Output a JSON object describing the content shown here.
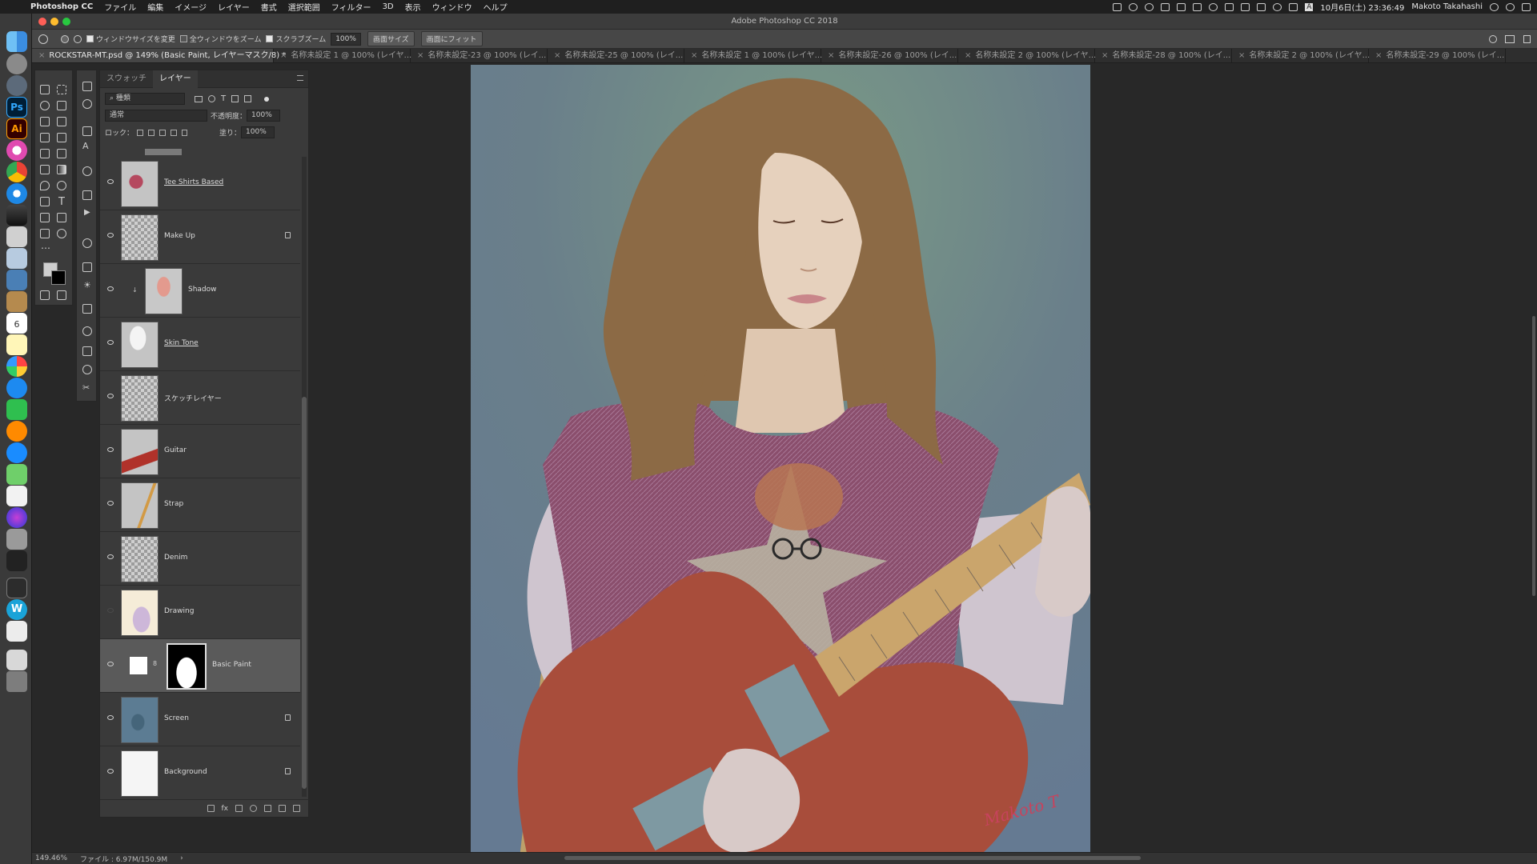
{
  "menubar": {
    "app_name": "Photoshop CC",
    "items": [
      "ファイル",
      "編集",
      "イメージ",
      "レイヤー",
      "書式",
      "選択範囲",
      "フィルター",
      "3D",
      "表示",
      "ウィンドウ",
      "ヘルプ"
    ],
    "datetime": "10月6日(土) 23:36:49",
    "user": "Makoto Takahashi",
    "input_mode": "A"
  },
  "window": {
    "title": "Adobe Photoshop CC 2018"
  },
  "options": {
    "resize_windows_label": "ウィンドウサイズを変更",
    "zoom_all_label": "全ウィンドウをズーム",
    "scrubby_zoom_label": "スクラブズーム",
    "zoom_value": "100%",
    "fit_screen_button": "画面サイズ",
    "fill_screen_button": "画面にフィット"
  },
  "tabs": [
    "ROCKSTAR-MT.psd @ 149% (Basic Paint, レイヤーマスク/8) *",
    "名称未設定 1 @ 100% (レイヤ...",
    "名称未設定-23 @ 100% (レイ...",
    "名称未設定-25 @ 100% (レイ...",
    "名称未設定 1 @ 100% (レイヤ...",
    "名称未設定-26 @ 100% (レイ...",
    "名称未設定 2 @ 100% (レイヤ...",
    "名称未設定-28 @ 100% (レイ...",
    "名称未設定 2 @ 100% (レイヤ...",
    "名称未設定-29 @ 100% (レイ..."
  ],
  "layers_panel": {
    "tab_swatches": "スウォッチ",
    "tab_layers": "レイヤー",
    "filter_kind": "種類",
    "blend_mode": "通常",
    "opacity_label": "不透明度：",
    "opacity_value": "100%",
    "lock_label": "ロック：",
    "fill_label": "塗り：",
    "fill_value": "100%",
    "layers": [
      {
        "name": "Tee Shirts Based"
      },
      {
        "name": "Make Up"
      },
      {
        "name": "Shadow"
      },
      {
        "name": "Skin Tone"
      },
      {
        "name": "スケッチレイヤー"
      },
      {
        "name": "Guitar"
      },
      {
        "name": "Strap"
      },
      {
        "name": "Denim"
      },
      {
        "name": "Drawing"
      },
      {
        "name": "Basic Paint"
      },
      {
        "name": "Screen"
      },
      {
        "name": "Background"
      }
    ]
  },
  "artwork": {
    "signature": "Makoto T"
  },
  "status": {
    "zoom": "149.46%",
    "doc_size": "ファイル : 6.97M/150.9M"
  },
  "colors": {
    "accent_ps": "#31a8ff",
    "accent_ai": "#ff9a00"
  }
}
